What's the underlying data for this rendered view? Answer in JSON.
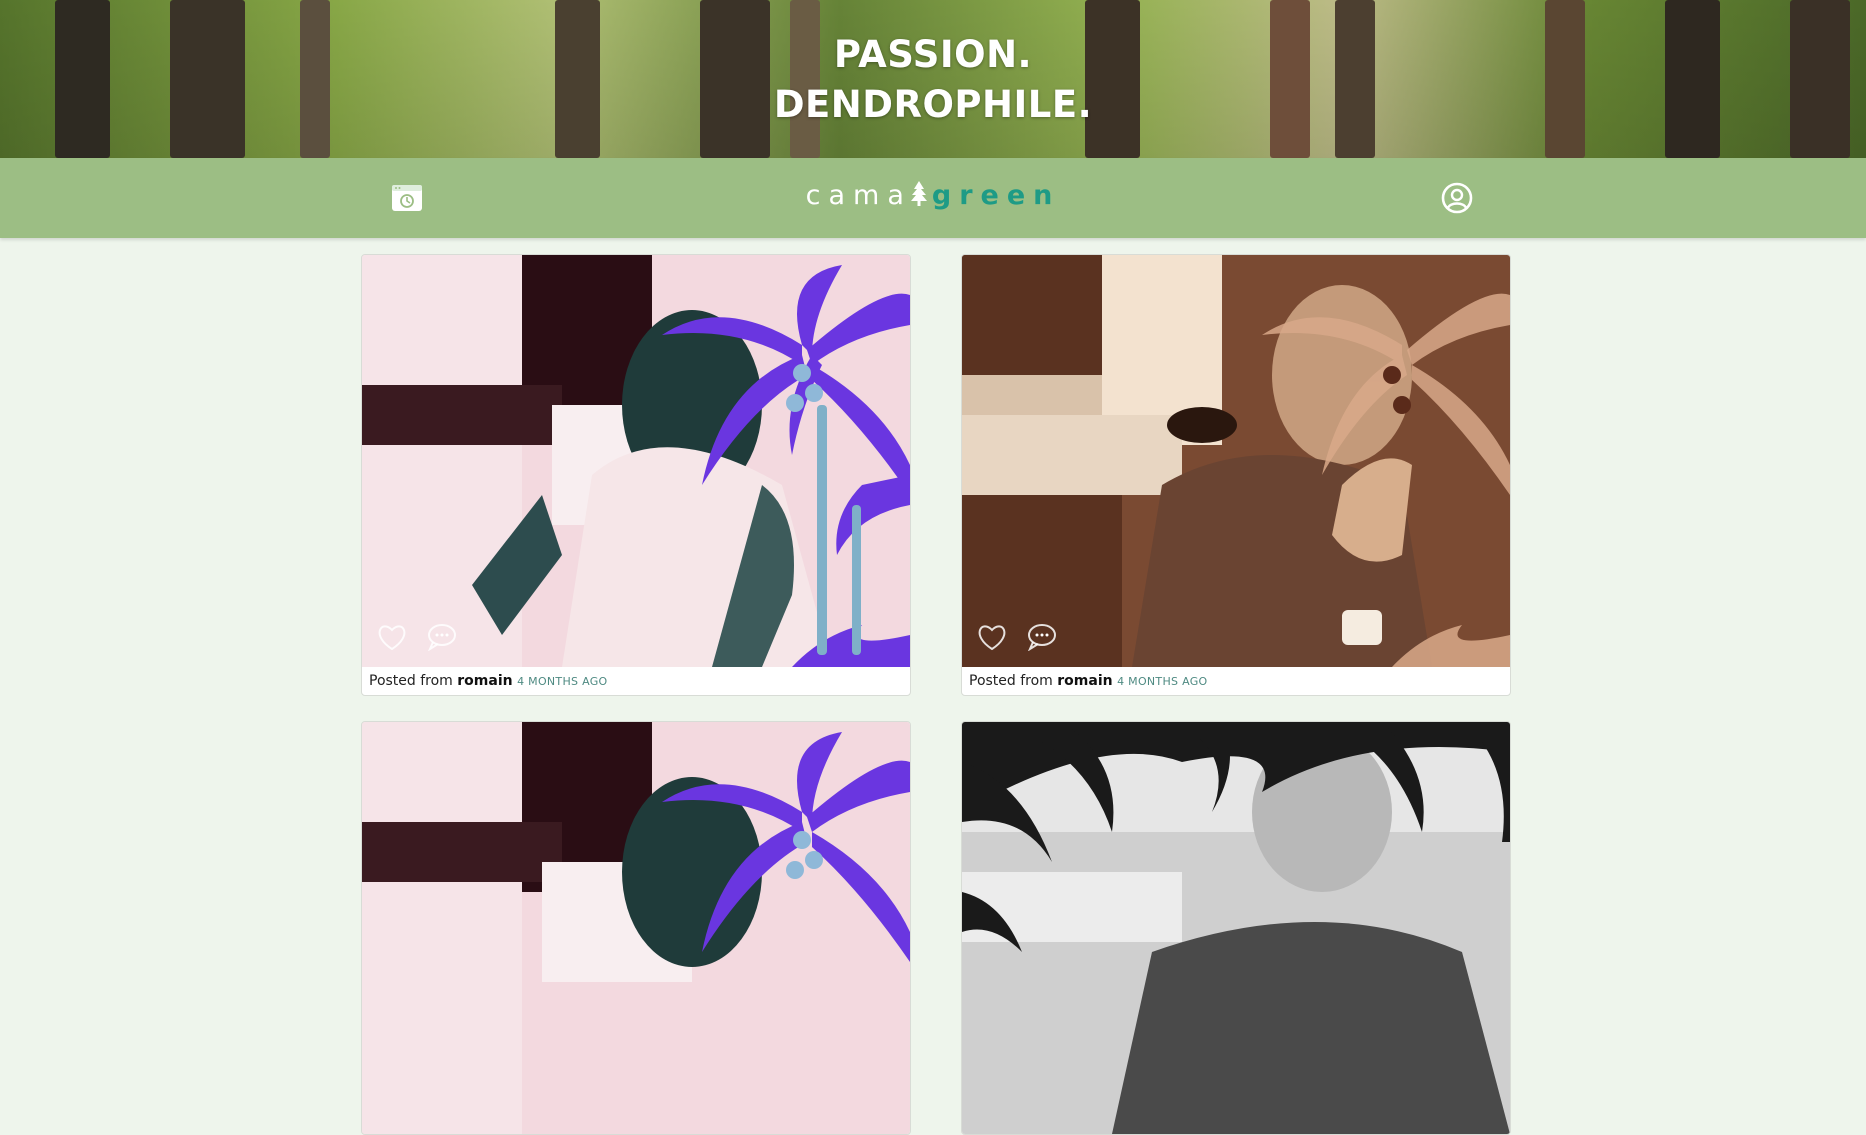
{
  "hero": {
    "line1": "PASSION.",
    "line2": "DENDROPHILE."
  },
  "nav": {
    "camera_icon": "camera-icon",
    "profile_icon": "user-circle-icon",
    "logo_left": "cama",
    "logo_right": "green",
    "logo_icon": "tree-icon"
  },
  "colors": {
    "navbar": "#9cbe84",
    "logo_green": "#1e9b86",
    "page_bg": "#eef5ec",
    "time_text": "#4e8a82"
  },
  "posts": [
    {
      "prefix": "Posted from",
      "author": "romain",
      "time": "4 MONTHS AGO",
      "filter": "inverted-pink",
      "like_icon": "heart-icon",
      "comment_icon": "speech-bubble-icon"
    },
    {
      "prefix": "Posted from",
      "author": "romain",
      "time": "4 MONTHS AGO",
      "filter": "sepia-brown",
      "like_icon": "heart-icon",
      "comment_icon": "speech-bubble-icon"
    },
    {
      "filter": "inverted-pink"
    },
    {
      "filter": "grayscale"
    }
  ]
}
